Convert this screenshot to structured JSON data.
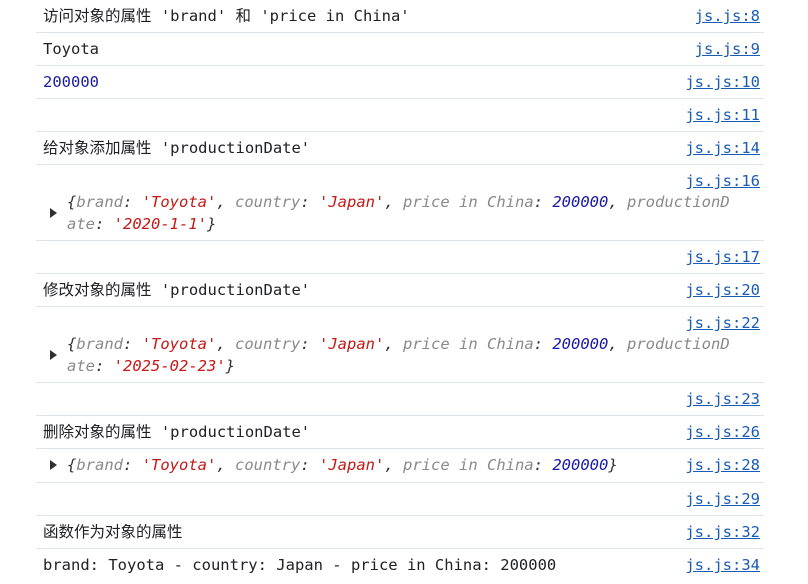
{
  "rows": [
    {
      "text": "访问对象的属性 'brand' 和 'price in China'",
      "source": "js.js:8"
    },
    {
      "text": "Toyota",
      "source": "js.js:9"
    },
    {
      "text": "200000",
      "source": "js.js:10"
    },
    {
      "text": "",
      "source": "js.js:11"
    },
    {
      "text": "给对象添加属性 'productionDate'",
      "source": "js.js:14"
    },
    {
      "source": "js.js:16",
      "object": {
        "brand": "'Toyota'",
        "country": "'Japan'",
        "price_in_china": "200000",
        "productionDate": "'2020-1-1'"
      }
    },
    {
      "text": "",
      "source": "js.js:17"
    },
    {
      "text": "修改对象的属性 'productionDate'",
      "source": "js.js:20"
    },
    {
      "source": "js.js:22",
      "object": {
        "brand": "'Toyota'",
        "country": "'Japan'",
        "price_in_china": "200000",
        "productionDate": "'2025-02-23'"
      }
    },
    {
      "text": "",
      "source": "js.js:23"
    },
    {
      "text": "删除对象的属性 'productionDate'",
      "source": "js.js:26"
    },
    {
      "source": "js.js:28",
      "object": {
        "brand": "'Toyota'",
        "country": "'Japan'",
        "price_in_china": "200000"
      }
    },
    {
      "text": "",
      "source": "js.js:29"
    },
    {
      "text": "函数作为对象的属性",
      "source": "js.js:32"
    },
    {
      "text": "brand: Toyota - country: Japan - price in China: 200000",
      "source": "js.js:34"
    }
  ],
  "keys": {
    "brand": "brand",
    "country": "country",
    "price_in_china": "price in China",
    "productionDate_part1": "productionD",
    "productionDate_part2": "ate"
  },
  "colors": {
    "string": "#c41a16",
    "number": "#1a1aa6",
    "key": "#8a8a8a",
    "link": "#1a5bb5",
    "divider": "#dfe4ea"
  }
}
